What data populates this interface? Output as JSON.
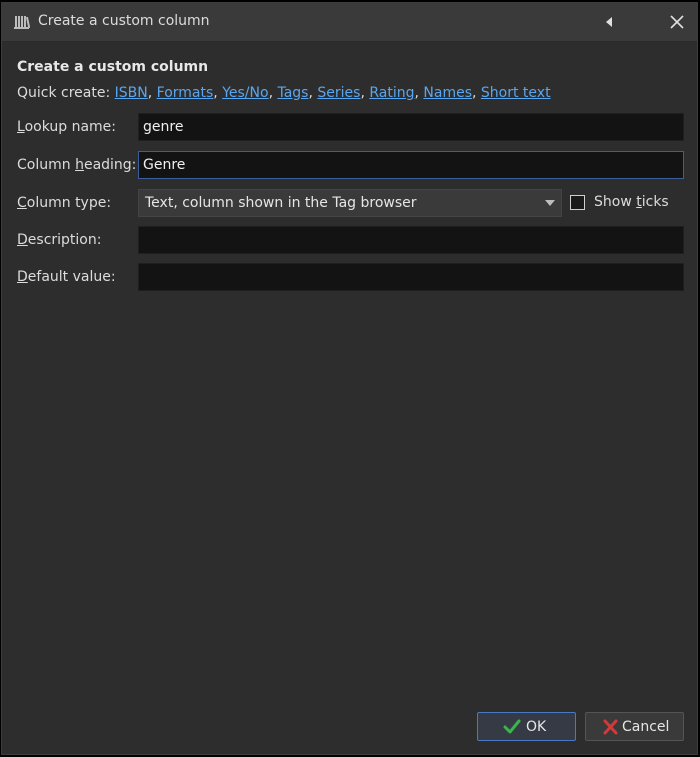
{
  "window": {
    "title": "Create a custom column",
    "icon": "library-icon"
  },
  "heading": "Create a custom column",
  "quick_create": {
    "label": "Quick create:",
    "links": [
      "ISBN",
      "Formats",
      "Yes/No",
      "Tags",
      "Series",
      "Rating",
      "Names",
      "Short text"
    ]
  },
  "fields": {
    "lookup_name": {
      "label_pre": "",
      "label_u": "L",
      "label_post": "ookup name:",
      "value": "genre"
    },
    "column_heading": {
      "label_pre": "Column ",
      "label_u": "h",
      "label_post": "eading:",
      "value": "Genre"
    },
    "column_type": {
      "label_pre": "",
      "label_u": "C",
      "label_post": "olumn type:",
      "value": "Text, column shown in the Tag browser"
    },
    "description": {
      "label_pre": "",
      "label_u": "D",
      "label_post": "escription:",
      "value": ""
    },
    "default_value": {
      "label_pre": "",
      "label_u": "D",
      "label_post": "efault value:",
      "value": ""
    }
  },
  "show_ticks": {
    "label_pre": "Show ",
    "label_u": "t",
    "label_post": "icks",
    "checked": false
  },
  "buttons": {
    "ok": "OK",
    "cancel": "Cancel"
  },
  "colors": {
    "link": "#5aa6ee",
    "ok_check": "#3cb44b",
    "cancel_x": "#d23a3a",
    "focus_border": "#3a5f9a"
  }
}
